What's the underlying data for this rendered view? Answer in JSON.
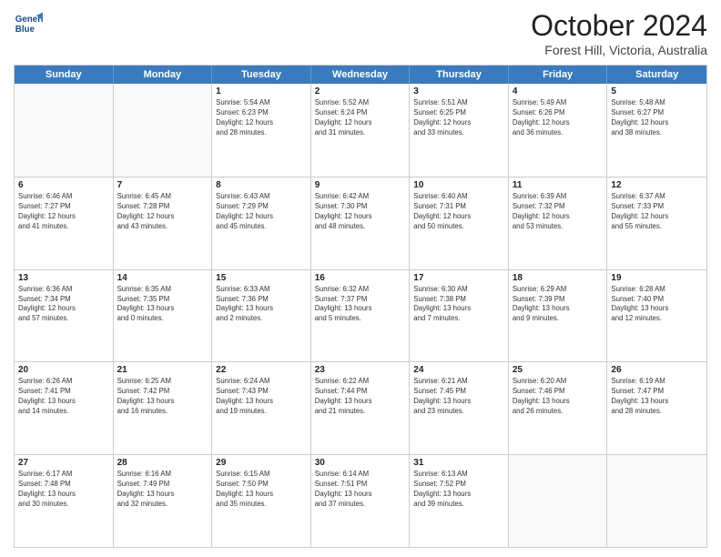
{
  "header": {
    "logo_line1": "General",
    "logo_line2": "Blue",
    "month_title": "October 2024",
    "location": "Forest Hill, Victoria, Australia"
  },
  "days_of_week": [
    "Sunday",
    "Monday",
    "Tuesday",
    "Wednesday",
    "Thursday",
    "Friday",
    "Saturday"
  ],
  "weeks": [
    [
      {
        "day": "",
        "info": ""
      },
      {
        "day": "",
        "info": ""
      },
      {
        "day": "1",
        "info": "Sunrise: 5:54 AM\nSunset: 6:23 PM\nDaylight: 12 hours\nand 28 minutes."
      },
      {
        "day": "2",
        "info": "Sunrise: 5:52 AM\nSunset: 6:24 PM\nDaylight: 12 hours\nand 31 minutes."
      },
      {
        "day": "3",
        "info": "Sunrise: 5:51 AM\nSunset: 6:25 PM\nDaylight: 12 hours\nand 33 minutes."
      },
      {
        "day": "4",
        "info": "Sunrise: 5:49 AM\nSunset: 6:26 PM\nDaylight: 12 hours\nand 36 minutes."
      },
      {
        "day": "5",
        "info": "Sunrise: 5:48 AM\nSunset: 6:27 PM\nDaylight: 12 hours\nand 38 minutes."
      }
    ],
    [
      {
        "day": "6",
        "info": "Sunrise: 6:46 AM\nSunset: 7:27 PM\nDaylight: 12 hours\nand 41 minutes."
      },
      {
        "day": "7",
        "info": "Sunrise: 6:45 AM\nSunset: 7:28 PM\nDaylight: 12 hours\nand 43 minutes."
      },
      {
        "day": "8",
        "info": "Sunrise: 6:43 AM\nSunset: 7:29 PM\nDaylight: 12 hours\nand 45 minutes."
      },
      {
        "day": "9",
        "info": "Sunrise: 6:42 AM\nSunset: 7:30 PM\nDaylight: 12 hours\nand 48 minutes."
      },
      {
        "day": "10",
        "info": "Sunrise: 6:40 AM\nSunset: 7:31 PM\nDaylight: 12 hours\nand 50 minutes."
      },
      {
        "day": "11",
        "info": "Sunrise: 6:39 AM\nSunset: 7:32 PM\nDaylight: 12 hours\nand 53 minutes."
      },
      {
        "day": "12",
        "info": "Sunrise: 6:37 AM\nSunset: 7:33 PM\nDaylight: 12 hours\nand 55 minutes."
      }
    ],
    [
      {
        "day": "13",
        "info": "Sunrise: 6:36 AM\nSunset: 7:34 PM\nDaylight: 12 hours\nand 57 minutes."
      },
      {
        "day": "14",
        "info": "Sunrise: 6:35 AM\nSunset: 7:35 PM\nDaylight: 13 hours\nand 0 minutes."
      },
      {
        "day": "15",
        "info": "Sunrise: 6:33 AM\nSunset: 7:36 PM\nDaylight: 13 hours\nand 2 minutes."
      },
      {
        "day": "16",
        "info": "Sunrise: 6:32 AM\nSunset: 7:37 PM\nDaylight: 13 hours\nand 5 minutes."
      },
      {
        "day": "17",
        "info": "Sunrise: 6:30 AM\nSunset: 7:38 PM\nDaylight: 13 hours\nand 7 minutes."
      },
      {
        "day": "18",
        "info": "Sunrise: 6:29 AM\nSunset: 7:39 PM\nDaylight: 13 hours\nand 9 minutes."
      },
      {
        "day": "19",
        "info": "Sunrise: 6:28 AM\nSunset: 7:40 PM\nDaylight: 13 hours\nand 12 minutes."
      }
    ],
    [
      {
        "day": "20",
        "info": "Sunrise: 6:26 AM\nSunset: 7:41 PM\nDaylight: 13 hours\nand 14 minutes."
      },
      {
        "day": "21",
        "info": "Sunrise: 6:25 AM\nSunset: 7:42 PM\nDaylight: 13 hours\nand 16 minutes."
      },
      {
        "day": "22",
        "info": "Sunrise: 6:24 AM\nSunset: 7:43 PM\nDaylight: 13 hours\nand 19 minutes."
      },
      {
        "day": "23",
        "info": "Sunrise: 6:22 AM\nSunset: 7:44 PM\nDaylight: 13 hours\nand 21 minutes."
      },
      {
        "day": "24",
        "info": "Sunrise: 6:21 AM\nSunset: 7:45 PM\nDaylight: 13 hours\nand 23 minutes."
      },
      {
        "day": "25",
        "info": "Sunrise: 6:20 AM\nSunset: 7:46 PM\nDaylight: 13 hours\nand 26 minutes."
      },
      {
        "day": "26",
        "info": "Sunrise: 6:19 AM\nSunset: 7:47 PM\nDaylight: 13 hours\nand 28 minutes."
      }
    ],
    [
      {
        "day": "27",
        "info": "Sunrise: 6:17 AM\nSunset: 7:48 PM\nDaylight: 13 hours\nand 30 minutes."
      },
      {
        "day": "28",
        "info": "Sunrise: 6:16 AM\nSunset: 7:49 PM\nDaylight: 13 hours\nand 32 minutes."
      },
      {
        "day": "29",
        "info": "Sunrise: 6:15 AM\nSunset: 7:50 PM\nDaylight: 13 hours\nand 35 minutes."
      },
      {
        "day": "30",
        "info": "Sunrise: 6:14 AM\nSunset: 7:51 PM\nDaylight: 13 hours\nand 37 minutes."
      },
      {
        "day": "31",
        "info": "Sunrise: 6:13 AM\nSunset: 7:52 PM\nDaylight: 13 hours\nand 39 minutes."
      },
      {
        "day": "",
        "info": ""
      },
      {
        "day": "",
        "info": ""
      }
    ]
  ]
}
